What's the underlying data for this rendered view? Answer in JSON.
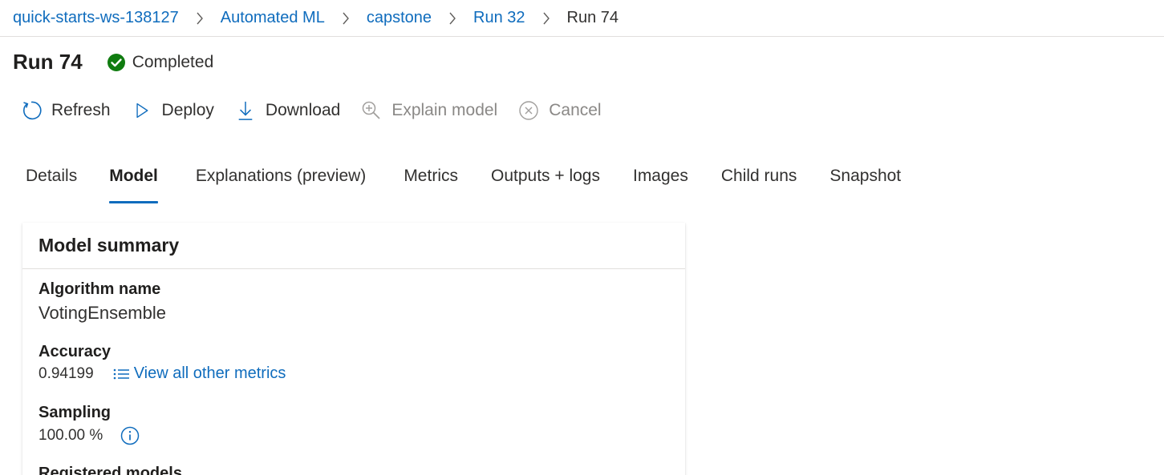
{
  "breadcrumb": {
    "items": [
      "quick-starts-ws-138127",
      "Automated ML",
      "capstone",
      "Run 32"
    ],
    "current": "Run 74"
  },
  "header": {
    "title": "Run 74",
    "status": "Completed",
    "status_color": "#107c10"
  },
  "toolbar": {
    "refresh": "Refresh",
    "deploy": "Deploy",
    "download": "Download",
    "explain": "Explain model",
    "cancel": "Cancel"
  },
  "tabs": [
    "Details",
    "Model",
    "Explanations (preview)",
    "Metrics",
    "Outputs + logs",
    "Images",
    "Child runs",
    "Snapshot"
  ],
  "active_tab": "Model",
  "accent_color": "#0f6cbd",
  "card": {
    "title": "Model summary",
    "algorithm_label": "Algorithm name",
    "algorithm_value": "VotingEnsemble",
    "accuracy_label": "Accuracy",
    "accuracy_value": "0.94199",
    "metrics_link": "View all other metrics",
    "sampling_label": "Sampling",
    "sampling_value": "100.00 %",
    "registered_label": "Registered models"
  },
  "icons": [
    "chevron-right-icon",
    "check-circle-icon",
    "refresh-icon",
    "play-icon",
    "download-icon",
    "explain-icon",
    "cancel-icon",
    "list-icon",
    "info-icon"
  ]
}
